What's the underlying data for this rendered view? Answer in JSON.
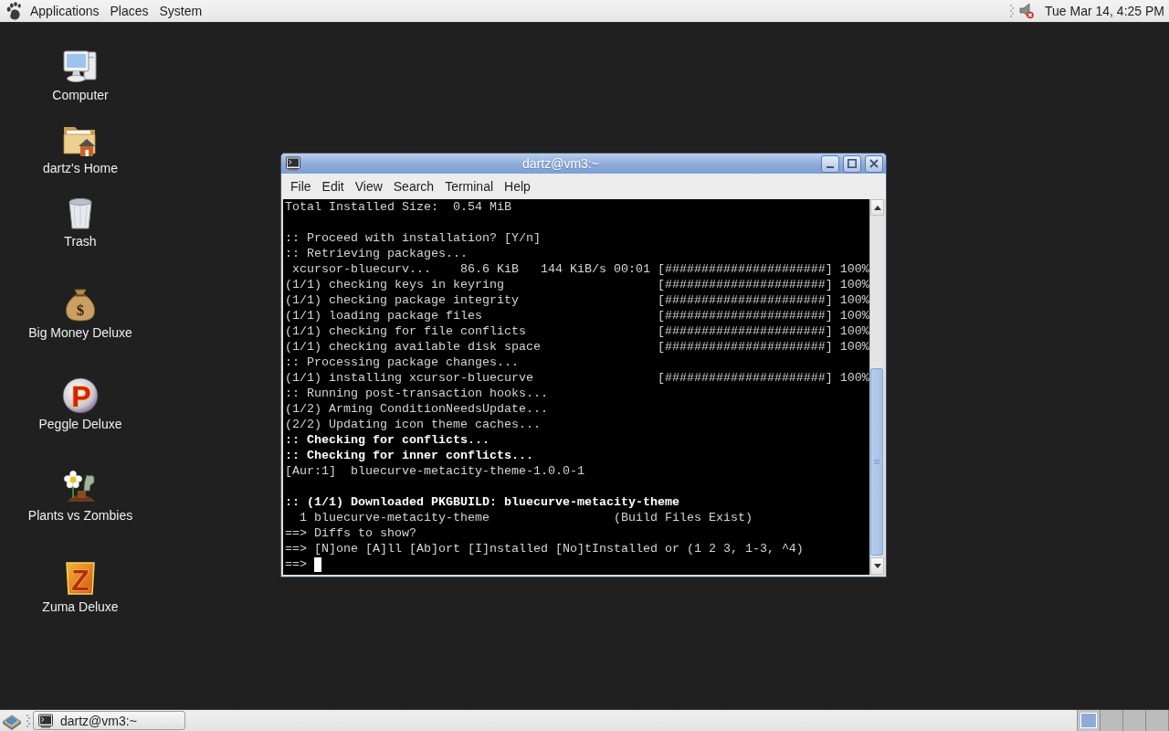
{
  "top_panel": {
    "menus": [
      {
        "label": "Applications"
      },
      {
        "label": "Places"
      },
      {
        "label": "System"
      }
    ],
    "volume": {
      "muted": true
    },
    "clock": "Tue Mar 14, 4:25 PM"
  },
  "desktop_icons": [
    {
      "kind": "computer",
      "label": "Computer"
    },
    {
      "kind": "home",
      "label": "dartz's Home"
    },
    {
      "kind": "trash",
      "label": "Trash"
    },
    {
      "kind": "money",
      "label": "Big Money Deluxe",
      "glyph": "$"
    },
    {
      "kind": "peggle",
      "label": "Peggle Deluxe",
      "glyph": "P"
    },
    {
      "kind": "plants",
      "label": "Plants vs Zombies"
    },
    {
      "kind": "zuma",
      "label": "Zuma Deluxe",
      "glyph": "Z"
    }
  ],
  "terminal_window": {
    "title": "dartz@vm3:~",
    "menu": [
      {
        "label": "File"
      },
      {
        "label": "Edit"
      },
      {
        "label": "View"
      },
      {
        "label": "Search"
      },
      {
        "label": "Terminal"
      },
      {
        "label": "Help"
      }
    ],
    "lines": [
      {
        "kind": "text",
        "bold": false,
        "text": "Total Installed Size:  0.54 MiB"
      },
      {
        "kind": "blank"
      },
      {
        "kind": "text",
        "bold": false,
        "text": ":: Proceed with installation? [Y/n]"
      },
      {
        "kind": "text",
        "bold": false,
        "text": ":: Retrieving packages..."
      },
      {
        "kind": "text",
        "bold": false,
        "text": " xcursor-bluecurv...    86.6 KiB   144 KiB/s 00:01 [######################] 100%"
      },
      {
        "kind": "text",
        "bold": false,
        "text": "(1/1) checking keys in keyring                     [######################] 100%"
      },
      {
        "kind": "text",
        "bold": false,
        "text": "(1/1) checking package integrity                   [######################] 100%"
      },
      {
        "kind": "text",
        "bold": false,
        "text": "(1/1) loading package files                        [######################] 100%"
      },
      {
        "kind": "text",
        "bold": false,
        "text": "(1/1) checking for file conflicts                  [######################] 100%"
      },
      {
        "kind": "text",
        "bold": false,
        "text": "(1/1) checking available disk space                [######################] 100%"
      },
      {
        "kind": "text",
        "bold": false,
        "text": ":: Processing package changes..."
      },
      {
        "kind": "text",
        "bold": false,
        "text": "(1/1) installing xcursor-bluecurve                 [######################] 100%"
      },
      {
        "kind": "text",
        "bold": false,
        "text": ":: Running post-transaction hooks..."
      },
      {
        "kind": "text",
        "bold": false,
        "text": "(1/2) Arming ConditionNeedsUpdate..."
      },
      {
        "kind": "text",
        "bold": false,
        "text": "(2/2) Updating icon theme caches..."
      },
      {
        "kind": "text",
        "bold": true,
        "text": ":: Checking for conflicts..."
      },
      {
        "kind": "text",
        "bold": true,
        "text": ":: Checking for inner conflicts..."
      },
      {
        "kind": "text",
        "bold": false,
        "text": "[Aur:1]  bluecurve-metacity-theme-1.0.0-1"
      },
      {
        "kind": "blank"
      },
      {
        "kind": "text",
        "bold": true,
        "text": ":: (1/1) Downloaded PKGBUILD: bluecurve-metacity-theme"
      },
      {
        "kind": "text",
        "bold": false,
        "text": "  1 bluecurve-metacity-theme                 (Build Files Exist)"
      },
      {
        "kind": "text",
        "bold": false,
        "text": "==> Diffs to show?"
      },
      {
        "kind": "text",
        "bold": false,
        "text": "==> [N]one [A]ll [Ab]ort [I]nstalled [No]tInstalled or (1 2 3, 1-3, ^4)"
      },
      {
        "kind": "prompt",
        "text": "==>"
      }
    ]
  },
  "taskbar": {
    "tasks": [
      {
        "label": "dartz@vm3:~",
        "selected": false
      }
    ],
    "workspaces": [
      {
        "selected": true
      },
      {
        "selected": false
      },
      {
        "selected": false
      },
      {
        "selected": false
      }
    ]
  }
}
